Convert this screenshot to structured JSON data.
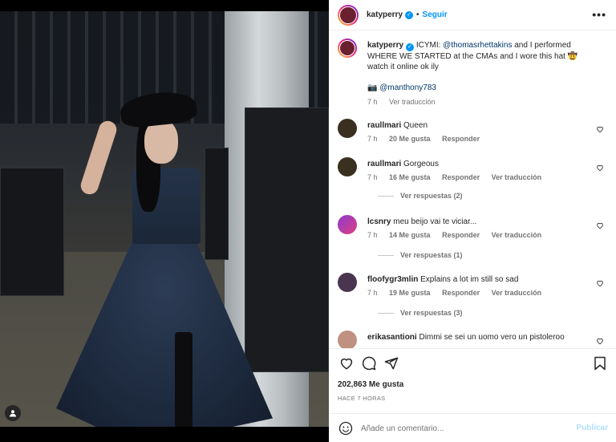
{
  "post": {
    "username": "katyperry",
    "follow_label": "Seguir",
    "dot": "•",
    "more_label": "•••"
  },
  "caption": {
    "username": "katyperry",
    "prefix": "ICYMI: ",
    "mention": "@thomasrhettakins",
    "body": " and I performed WHERE WE STARTED at the CMAs and I wore this hat 🤠 watch it online ok ily",
    "credit_icon": "📷",
    "credit_mention": "@manthony783",
    "time": "7 h",
    "translate": "Ver traducción"
  },
  "comments": [
    {
      "user": "raullmari",
      "text": "Queen",
      "time": "7 h",
      "likes": "20 Me gusta",
      "reply": "Responder",
      "translate": "",
      "replies": "",
      "color": "#3a3020"
    },
    {
      "user": "raullmari",
      "text": "Gorgeous",
      "time": "7 h",
      "likes": "16 Me gusta",
      "reply": "Responder",
      "translate": "Ver traducción",
      "replies": "Ver respuestas (2)",
      "color": "#3a3020"
    },
    {
      "user": "lcsnry",
      "text": "meu beijo vai te viciar...",
      "time": "7 h",
      "likes": "14 Me gusta",
      "reply": "Responder",
      "translate": "Ver traducción",
      "replies": "Ver respuestas (1)",
      "color": "#b03070"
    },
    {
      "user": "floofygr3mlin",
      "text": "Explains a lot im still so sad",
      "time": "7 h",
      "likes": "19 Me gusta",
      "reply": "Responder",
      "translate": "Ver traducción",
      "replies": "Ver respuestas (3)",
      "color": "#4a3550"
    },
    {
      "user": "erikasantioni",
      "text": "Dimmi se sei un uomo vero un pistoleroo",
      "time": "",
      "likes": "",
      "reply": "",
      "translate": "",
      "replies": "",
      "color": "#c09080"
    }
  ],
  "stats": {
    "likes": "202,863 Me gusta",
    "date": "HACE 7 HORAS"
  },
  "add_comment": {
    "placeholder": "Añade un comentario...",
    "publish": "Publicar"
  },
  "icons": {
    "heart": "heart-icon",
    "comment": "comment-icon",
    "share": "share-icon",
    "bookmark": "bookmark-icon",
    "emoji": "emoji-icon",
    "user_tag": "user-tag-icon"
  }
}
